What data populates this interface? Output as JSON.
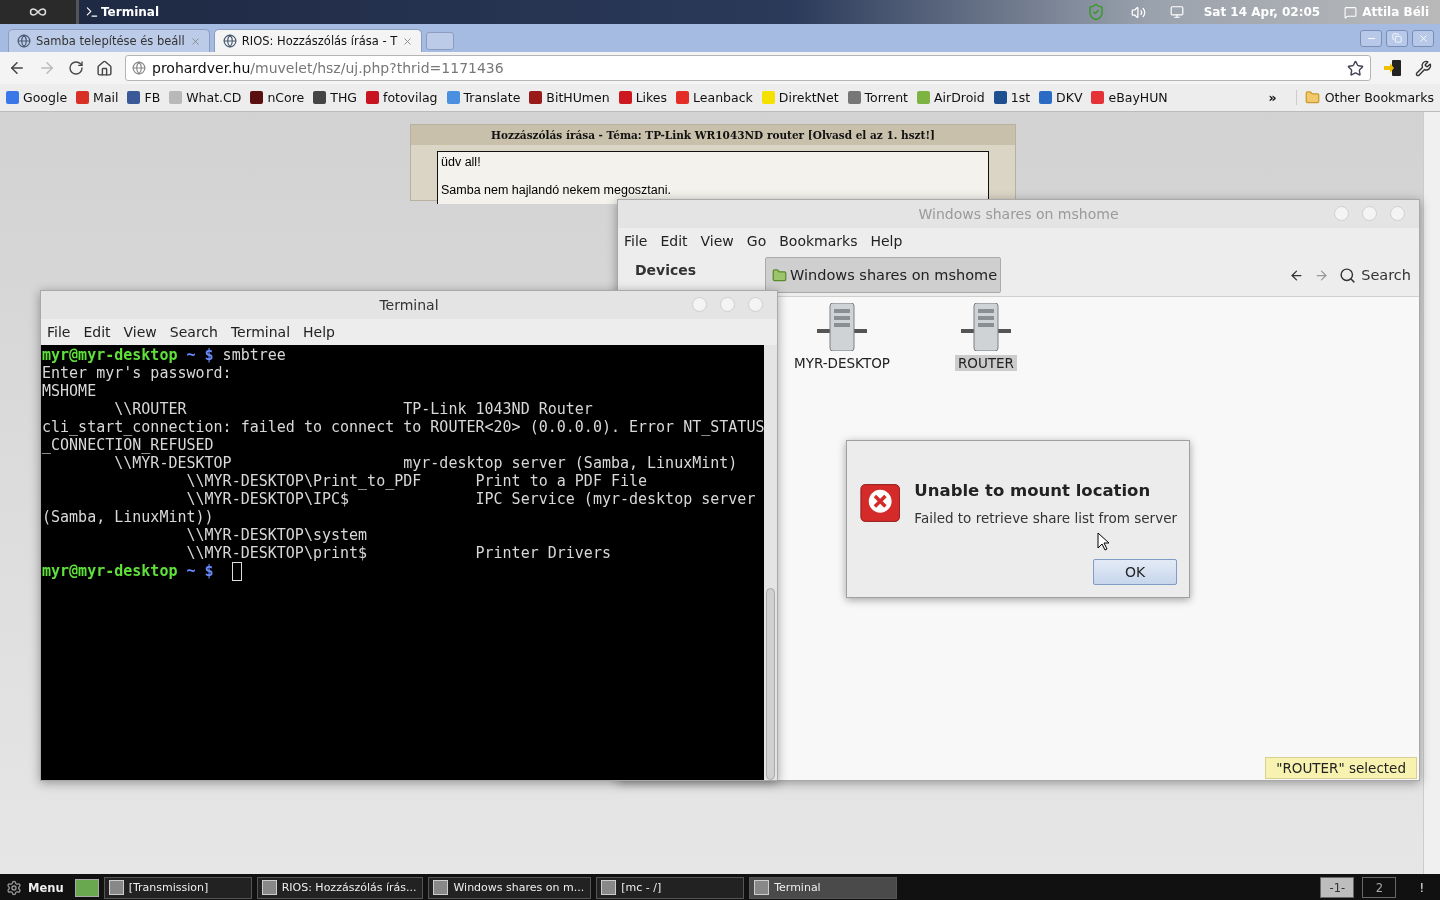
{
  "top_panel": {
    "app": "Terminal",
    "clock": "Sat 14 Apr, 02:05",
    "user": "Attila Béli"
  },
  "browser": {
    "tabs": [
      {
        "title": "Samba telepítése és beáll",
        "selected": false
      },
      {
        "title": "RIOS: Hozzászólás írása - T",
        "selected": true
      }
    ],
    "address": {
      "host": "prohardver.hu",
      "path": "/muvelet/hsz/uj.php?thrid=1171436"
    },
    "bookmarks": [
      {
        "label": "Google",
        "color": "#3b78e7"
      },
      {
        "label": "Mail",
        "color": "#d93025"
      },
      {
        "label": "FB",
        "color": "#3b5998"
      },
      {
        "label": "What.CD",
        "color": "#b8b8b8"
      },
      {
        "label": "nCore",
        "color": "#5a1010"
      },
      {
        "label": "THG",
        "color": "#444444"
      },
      {
        "label": "fotovilag",
        "color": "#c8141e"
      },
      {
        "label": "Translate",
        "color": "#4a8fe0"
      },
      {
        "label": "BitHUmen",
        "color": "#9a1a1a"
      },
      {
        "label": "Likes",
        "color": "#cc181e"
      },
      {
        "label": "Leanback",
        "color": "#e52d27"
      },
      {
        "label": "DirektNet",
        "color": "#f5e100"
      },
      {
        "label": "Torrent",
        "color": "#777777"
      },
      {
        "label": "AirDroid",
        "color": "#7cb342"
      },
      {
        "label": "1st",
        "color": "#1d4f91"
      },
      {
        "label": "DKV",
        "color": "#2a6cc4"
      },
      {
        "label": "eBayHUN",
        "color": "#e53238"
      }
    ],
    "more": "»",
    "other_bookmarks": "Other Bookmarks",
    "page": {
      "heading": "Hozzászólás írása - Téma: TP-Link WR1043ND router [Olvasd el az 1. hszt!]",
      "message_lines": [
        "üdv all!",
        "Samba nem hajlandó nekem megosztani."
      ]
    }
  },
  "file_manager": {
    "title": "Windows shares on mshome",
    "menu": [
      "File",
      "Edit",
      "View",
      "Go",
      "Bookmarks",
      "Help"
    ],
    "sidebar_heading": "Devices",
    "location": "Windows shares on mshome",
    "search": "Search",
    "items": [
      {
        "label": "MYR-DESKTOP",
        "selected": false
      },
      {
        "label": "ROUTER",
        "selected": true
      }
    ],
    "status": "\"ROUTER\" selected"
  },
  "terminal": {
    "title": "Terminal",
    "menu": [
      "File",
      "Edit",
      "View",
      "Search",
      "Terminal",
      "Help"
    ],
    "lines": [
      {
        "kind": "prompt",
        "user": "myr@myr-desktop",
        "path": "~ $",
        "command": "smbtree",
        "cursor": false
      },
      {
        "kind": "output",
        "text": "Enter myr's password:"
      },
      {
        "kind": "output",
        "text": "MSHOME"
      },
      {
        "kind": "output",
        "text": "        \\\\ROUTER                        TP-Link 1043ND Router"
      },
      {
        "kind": "output",
        "text": "cli_start_connection: failed to connect to ROUTER<20> (0.0.0.0). Error NT_STATUS"
      },
      {
        "kind": "output",
        "text": "_CONNECTION_REFUSED"
      },
      {
        "kind": "output",
        "text": "        \\\\MYR-DESKTOP                   myr-desktop server (Samba, LinuxMint)"
      },
      {
        "kind": "output",
        "text": "                \\\\MYR-DESKTOP\\Print_to_PDF      Print to a PDF File"
      },
      {
        "kind": "output",
        "text": "                \\\\MYR-DESKTOP\\IPC$              IPC Service (myr-desktop server"
      },
      {
        "kind": "output",
        "text": "(Samba, LinuxMint))"
      },
      {
        "kind": "output",
        "text": "                \\\\MYR-DESKTOP\\system"
      },
      {
        "kind": "output",
        "text": "                \\\\MYR-DESKTOP\\print$            Printer Drivers"
      },
      {
        "kind": "prompt",
        "user": "myr@myr-desktop",
        "path": "~ $",
        "cursor": true
      }
    ]
  },
  "dialog": {
    "title": "Unable to mount location",
    "message": "Failed to retrieve share list from server",
    "button": "OK"
  },
  "taskbar": {
    "menu": "Menu",
    "tasks": [
      {
        "label": "[Transmission]",
        "selected": false
      },
      {
        "label": "RIOS: Hozzászólás írás...",
        "selected": false
      },
      {
        "label": "Windows shares on m...",
        "selected": false
      },
      {
        "label": "[mc - /]",
        "selected": false
      },
      {
        "label": "Terminal",
        "selected": true
      }
    ],
    "workspaces": [
      {
        "label": "-1-",
        "selected": true
      },
      {
        "label": "2",
        "selected": false
      }
    ],
    "notice": "!"
  }
}
